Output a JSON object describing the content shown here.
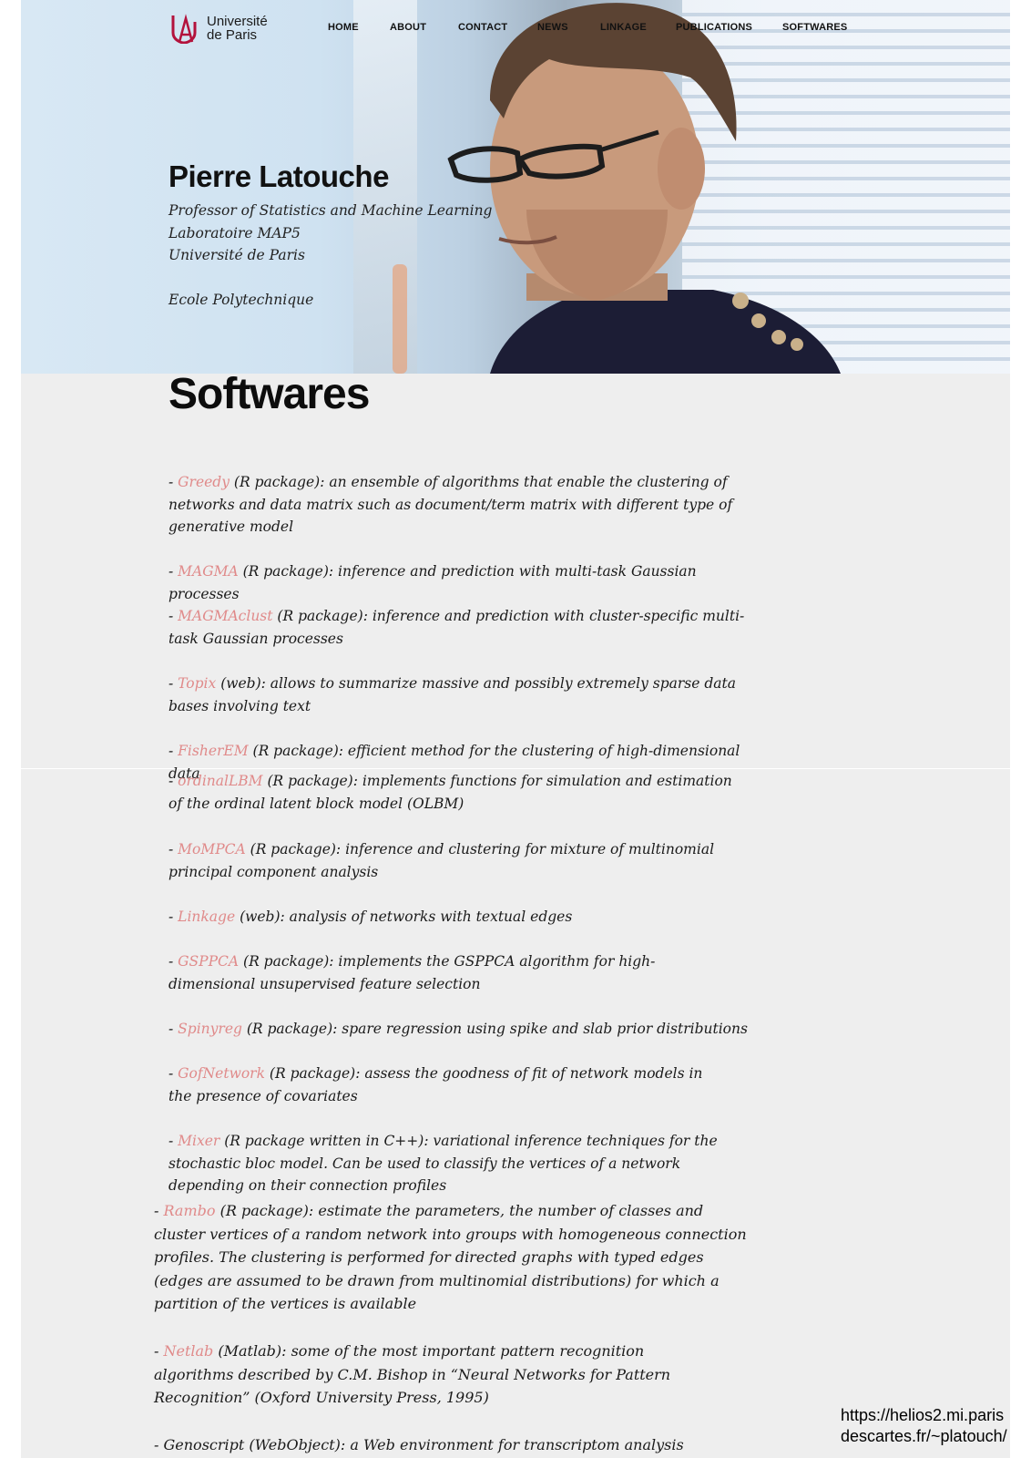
{
  "brand": {
    "logo_line1": "Université",
    "logo_line2": "de Paris",
    "accent": "#b3123c"
  },
  "nav": [
    {
      "label": "HOME"
    },
    {
      "label": "ABOUT"
    },
    {
      "label": "CONTACT"
    },
    {
      "label": "NEWS"
    },
    {
      "label": "LINKAGE"
    },
    {
      "label": "PUBLICATIONS"
    },
    {
      "label": "SOFTWARES"
    }
  ],
  "hero": {
    "name": "Pierre Latouche",
    "lines": [
      "Professor of Statistics and Machine Learning",
      "Laboratoire MAP5",
      "Université de Paris",
      "",
      "Ecole Polytechnique"
    ]
  },
  "page_title": "Softwares",
  "link_color": "#e08a8a",
  "softwares": [
    {
      "prefix": "- ",
      "name": "Greedy",
      "desc": " (R package): an ensemble of algorithms that enable the clustering of networks and data matrix such as document/term matrix with different type of generative model"
    },
    {
      "prefix": "- ",
      "name": "MAGMA",
      "desc": " (R package): inference and prediction with multi-task Gaussian processes"
    },
    {
      "prefix": "- ",
      "name": "MAGMAclust",
      "desc": " (R package): inference and prediction with cluster-specific multi-task Gaussian processes"
    },
    {
      "prefix": "- ",
      "name": "Topix",
      "desc": " (web):  allows to summarize massive and possibly extremely sparse data bases involving text"
    },
    {
      "prefix": "- ",
      "name": "FisherEM",
      "desc": " (R package): efficient method for the clustering of high-dimensional data"
    },
    {
      "prefix": "- ",
      "name": "ordinalLBM",
      "desc": " (R package): implements functions for simulation and estimation of the ordinal latent block model (OLBM)"
    },
    {
      "prefix": "- ",
      "name": "MoMPCA",
      "desc": " (R package): inference and clustering for mixture of multinomial principal component analysis"
    },
    {
      "prefix": "- ",
      "name": "Linkage",
      "desc": " (web): analysis of networks with textual edges"
    },
    {
      "prefix": "- ",
      "name": "GSPPCA",
      "desc": " (R package): implements the GSPPCA algorithm for high-dimensional unsupervised feature selection"
    },
    {
      "prefix": "- ",
      "name": "Spinyreg",
      "desc": " (R package): spare regression using spike and slab prior distributions"
    },
    {
      "prefix": "- ",
      "name": "GofNetwork",
      "desc": " (R package): assess the goodness of fit of network models in the presence of covariates"
    },
    {
      "prefix": "- ",
      "name": "Mixer",
      "desc": " (R package written in C++): variational inference techniques for the stochastic bloc model. Can be used to classify the vertices of a network depending on their connection profiles"
    },
    {
      "prefix": "- ",
      "name": "Rambo",
      "desc": " (R package): estimate the parameters, the number of classes and cluster vertices of a random network into groups with homogeneous connection profiles. The clustering is performed for directed graphs with typed edges (edges are assumed to be drawn from multinomial distributions) for which a partition of the vertices is available"
    },
    {
      "prefix": "- ",
      "name": "Netlab",
      "desc": " (Matlab): some of the most important pattern recognition algorithms described by C.M. Bishop in “Neural Networks for Pattern Recognition” (Oxford University Press, 1995)"
    },
    {
      "prefix": "- ",
      "name": "",
      "desc": "Genoscript (WebObject): a Web environment for transcriptom analysis"
    }
  ],
  "source_url": {
    "line1": "https://helios2.mi.paris",
    "line2": "descartes.fr/~platouch/"
  }
}
